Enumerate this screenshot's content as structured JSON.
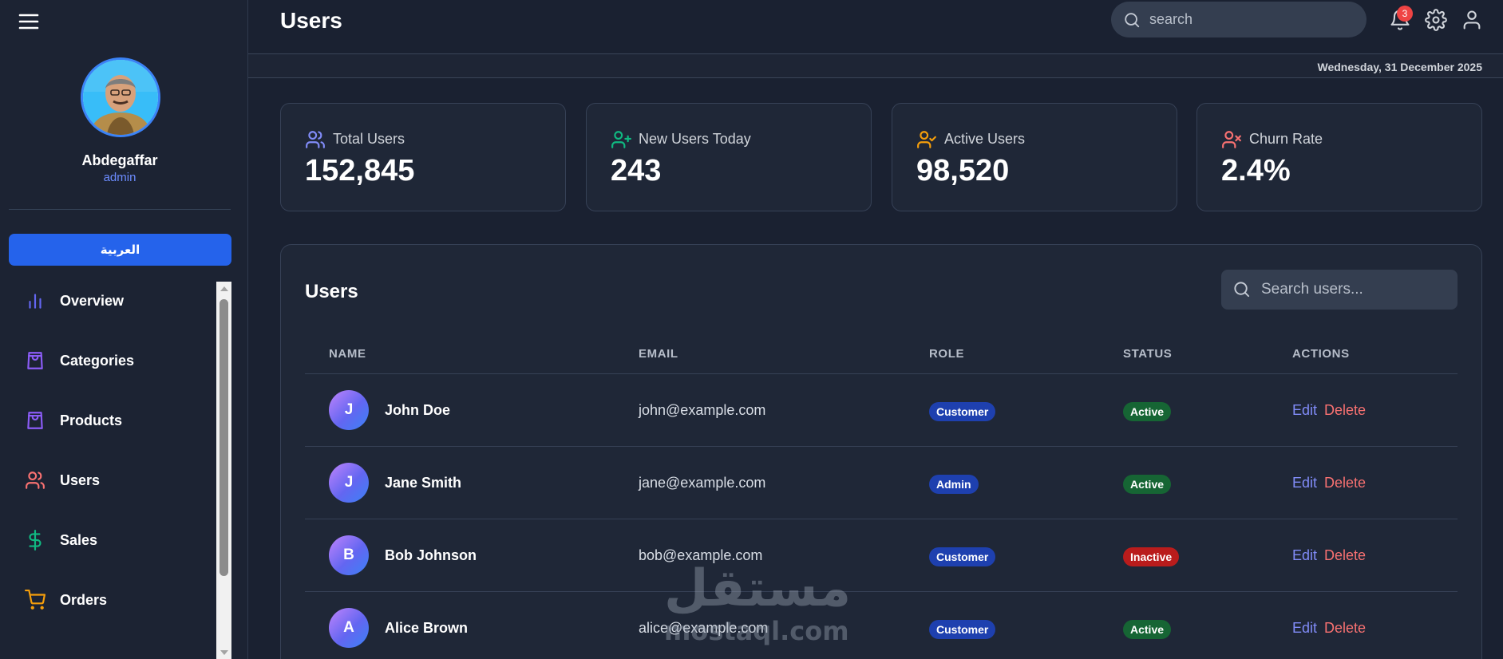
{
  "sidebar": {
    "profile_name": "Abdegaffar",
    "profile_role": "admin",
    "lang_button": "العربية",
    "items": [
      {
        "label": "Overview",
        "icon": "bar-chart-icon",
        "color": "#6366f1"
      },
      {
        "label": "Categories",
        "icon": "shopping-bag-icon",
        "color": "#8b5cf6"
      },
      {
        "label": "Products",
        "icon": "shopping-bag-icon",
        "color": "#8b5cf6"
      },
      {
        "label": "Users",
        "icon": "users-icon",
        "color": "#f87171"
      },
      {
        "label": "Sales",
        "icon": "dollar-icon",
        "color": "#10b981"
      },
      {
        "label": "Orders",
        "icon": "cart-icon",
        "color": "#f59e0b"
      }
    ]
  },
  "header": {
    "title": "Users",
    "search_placeholder": "search",
    "notification_count": "3",
    "date": "Wednesday, 31 December 2025"
  },
  "stats": [
    {
      "label": "Total Users",
      "value": "152,845",
      "icon": "users-icon",
      "color": "#818cf8"
    },
    {
      "label": "New Users Today",
      "value": "243",
      "icon": "user-plus-icon",
      "color": "#10b981"
    },
    {
      "label": "Active Users",
      "value": "98,520",
      "icon": "user-check-icon",
      "color": "#f59e0b"
    },
    {
      "label": "Churn Rate",
      "value": "2.4%",
      "icon": "user-x-icon",
      "color": "#f87171"
    }
  ],
  "users_panel": {
    "title": "Users",
    "search_placeholder": "Search users...",
    "columns": [
      "NAME",
      "EMAIL",
      "ROLE",
      "STATUS",
      "ACTIONS"
    ],
    "edit_label": "Edit",
    "delete_label": "Delete",
    "rows": [
      {
        "initial": "J",
        "name": "John Doe",
        "email": "john@example.com",
        "role": "Customer",
        "status": "Active"
      },
      {
        "initial": "J",
        "name": "Jane Smith",
        "email": "jane@example.com",
        "role": "Admin",
        "status": "Active"
      },
      {
        "initial": "B",
        "name": "Bob Johnson",
        "email": "bob@example.com",
        "role": "Customer",
        "status": "Inactive"
      },
      {
        "initial": "A",
        "name": "Alice Brown",
        "email": "alice@example.com",
        "role": "Customer",
        "status": "Active"
      }
    ]
  },
  "watermark": {
    "arabic": "مستقل",
    "latin": "mostaql.com"
  }
}
